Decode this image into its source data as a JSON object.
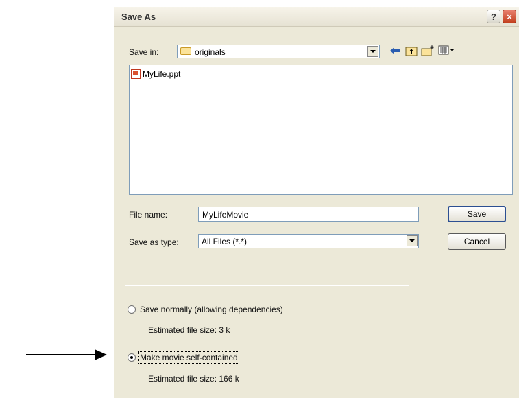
{
  "dialog": {
    "title": "Save As",
    "help_label": "?",
    "close_label": "×"
  },
  "save_in": {
    "label": "Save in:",
    "value": "originals"
  },
  "toolbar": {
    "icons": [
      "back-arrow-icon",
      "up-folder-icon",
      "new-folder-icon",
      "views-menu-icon"
    ]
  },
  "files": [
    {
      "name": "MyLife.ppt",
      "icon": "powerpoint-file-icon"
    }
  ],
  "file_name": {
    "label": "File name:",
    "value": "MyLifeMovie"
  },
  "save_as_type": {
    "label": "Save as type:",
    "value": "All Files (*.*)"
  },
  "buttons": {
    "save": "Save",
    "cancel": "Cancel"
  },
  "options": [
    {
      "label": "Save normally (allowing dependencies)",
      "size": "Estimated file size: 3 k",
      "selected": false
    },
    {
      "label": "Make movie self-contained",
      "size": "Estimated file size: 166 k",
      "selected": true
    }
  ]
}
